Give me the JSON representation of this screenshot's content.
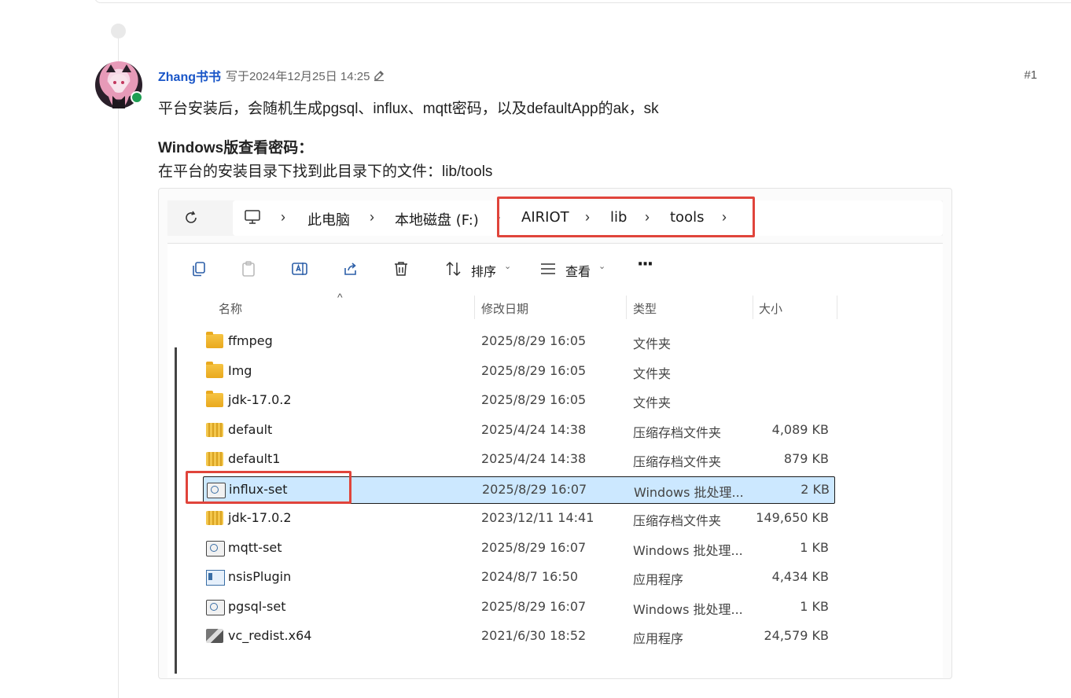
{
  "post": {
    "author": "Zhang书书",
    "meta": "写于2024年12月25日 14:25",
    "number": "#1",
    "line1": "平台安装后，会随机生成pgsql、influx、mqtt密码，以及defaultApp的ak，sk",
    "heading": "Windows版查看密码：",
    "line2": "在平台的安装目录下找到此目录下的文件：lib/tools"
  },
  "explorer": {
    "breadcrumbs": [
      "此电脑",
      "本地磁盘 (F:)",
      "AIRIOT",
      "lib",
      "tools"
    ],
    "toolbar": {
      "sort_label": "排序",
      "view_label": "查看",
      "more_label": "···"
    },
    "columns": {
      "name": "名称",
      "date": "修改日期",
      "type": "类型",
      "size": "大小"
    },
    "files": [
      {
        "name": "ffmpeg",
        "date": "2025/8/29 16:05",
        "type": "文件夹",
        "size": "",
        "icon": "folder-icon"
      },
      {
        "name": "Img",
        "date": "2025/8/29 16:05",
        "type": "文件夹",
        "size": "",
        "icon": "folder-icon"
      },
      {
        "name": "jdk-17.0.2",
        "date": "2025/8/29 16:05",
        "type": "文件夹",
        "size": "",
        "icon": "folder-icon"
      },
      {
        "name": "default",
        "date": "2025/4/24 14:38",
        "type": "压缩存档文件夹",
        "size": "4,089 KB",
        "icon": "zip-icon"
      },
      {
        "name": "default1",
        "date": "2025/4/24 14:38",
        "type": "压缩存档文件夹",
        "size": "879 KB",
        "icon": "zip-icon"
      },
      {
        "name": "influx-set",
        "date": "2025/8/29 16:07",
        "type": "Windows 批处理...",
        "size": "2 KB",
        "icon": "batch-file-icon",
        "selected": true
      },
      {
        "name": "jdk-17.0.2",
        "date": "2023/12/11 14:41",
        "type": "压缩存档文件夹",
        "size": "149,650 KB",
        "icon": "zip-icon"
      },
      {
        "name": "mqtt-set",
        "date": "2025/8/29 16:07",
        "type": "Windows 批处理...",
        "size": "1 KB",
        "icon": "batch-file-icon"
      },
      {
        "name": "nsisPlugin",
        "date": "2024/8/7 16:50",
        "type": "应用程序",
        "size": "4,434 KB",
        "icon": "application-icon"
      },
      {
        "name": "pgsql-set",
        "date": "2025/8/29 16:07",
        "type": "Windows 批处理...",
        "size": "1 KB",
        "icon": "batch-file-icon"
      },
      {
        "name": "vc_redist.x64",
        "date": "2021/6/30 18:52",
        "type": "应用程序",
        "size": "24,579 KB",
        "icon": "installer-icon"
      }
    ],
    "highlight_color": "#e0443b",
    "selection_color": "#cce8ff"
  }
}
